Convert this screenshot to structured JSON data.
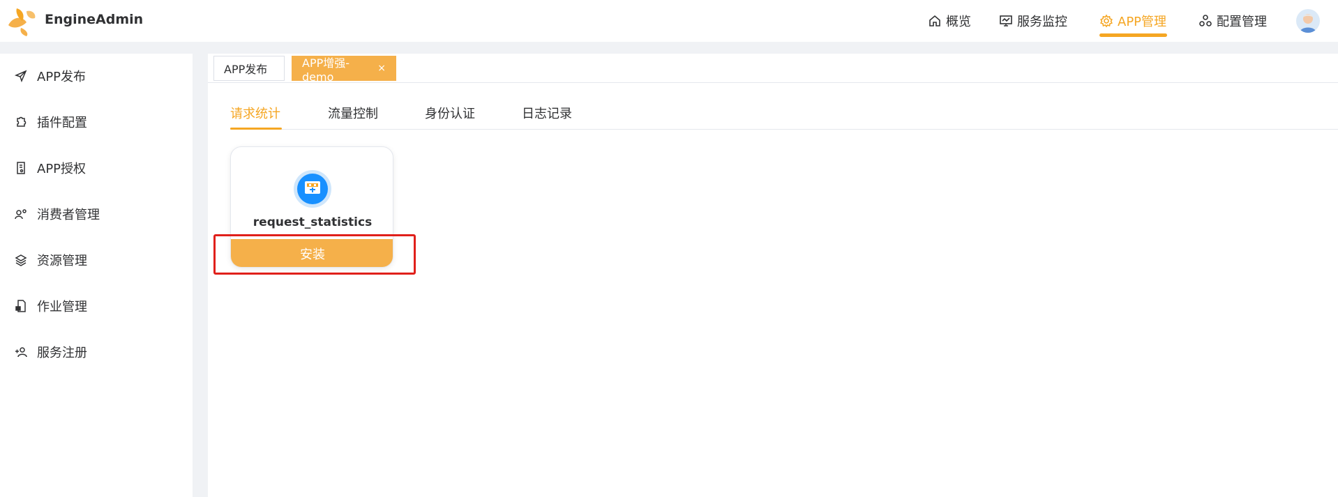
{
  "header": {
    "brand": "EngineAdmin",
    "nav": [
      {
        "label": "概览",
        "icon": "home-icon"
      },
      {
        "label": "服务监控",
        "icon": "monitor-icon"
      },
      {
        "label": "APP管理",
        "icon": "gear-icon",
        "active": true
      },
      {
        "label": "配置管理",
        "icon": "apps-icon"
      }
    ],
    "accent_color": "#f5a623"
  },
  "sidebar": {
    "items": [
      {
        "label": "APP发布",
        "icon": "send-icon"
      },
      {
        "label": "插件配置",
        "icon": "puzzle-icon"
      },
      {
        "label": "APP授权",
        "icon": "document-key-icon"
      },
      {
        "label": "消费者管理",
        "icon": "user-settings-icon"
      },
      {
        "label": "资源管理",
        "icon": "layers-icon"
      },
      {
        "label": "作业管理",
        "icon": "file-lock-icon"
      },
      {
        "label": "服务注册",
        "icon": "user-add-icon"
      }
    ]
  },
  "page_tabs": [
    {
      "label": "APP发布"
    },
    {
      "label": "APP增强-demo",
      "close": "×",
      "active": true
    }
  ],
  "sub_tabs": [
    {
      "label": "请求统计",
      "active": true
    },
    {
      "label": "流量控制"
    },
    {
      "label": "身份认证"
    },
    {
      "label": "日志记录"
    }
  ],
  "plugin_card": {
    "title": "request_statistics",
    "icon": "plugin-icon",
    "install_label": "安装"
  }
}
